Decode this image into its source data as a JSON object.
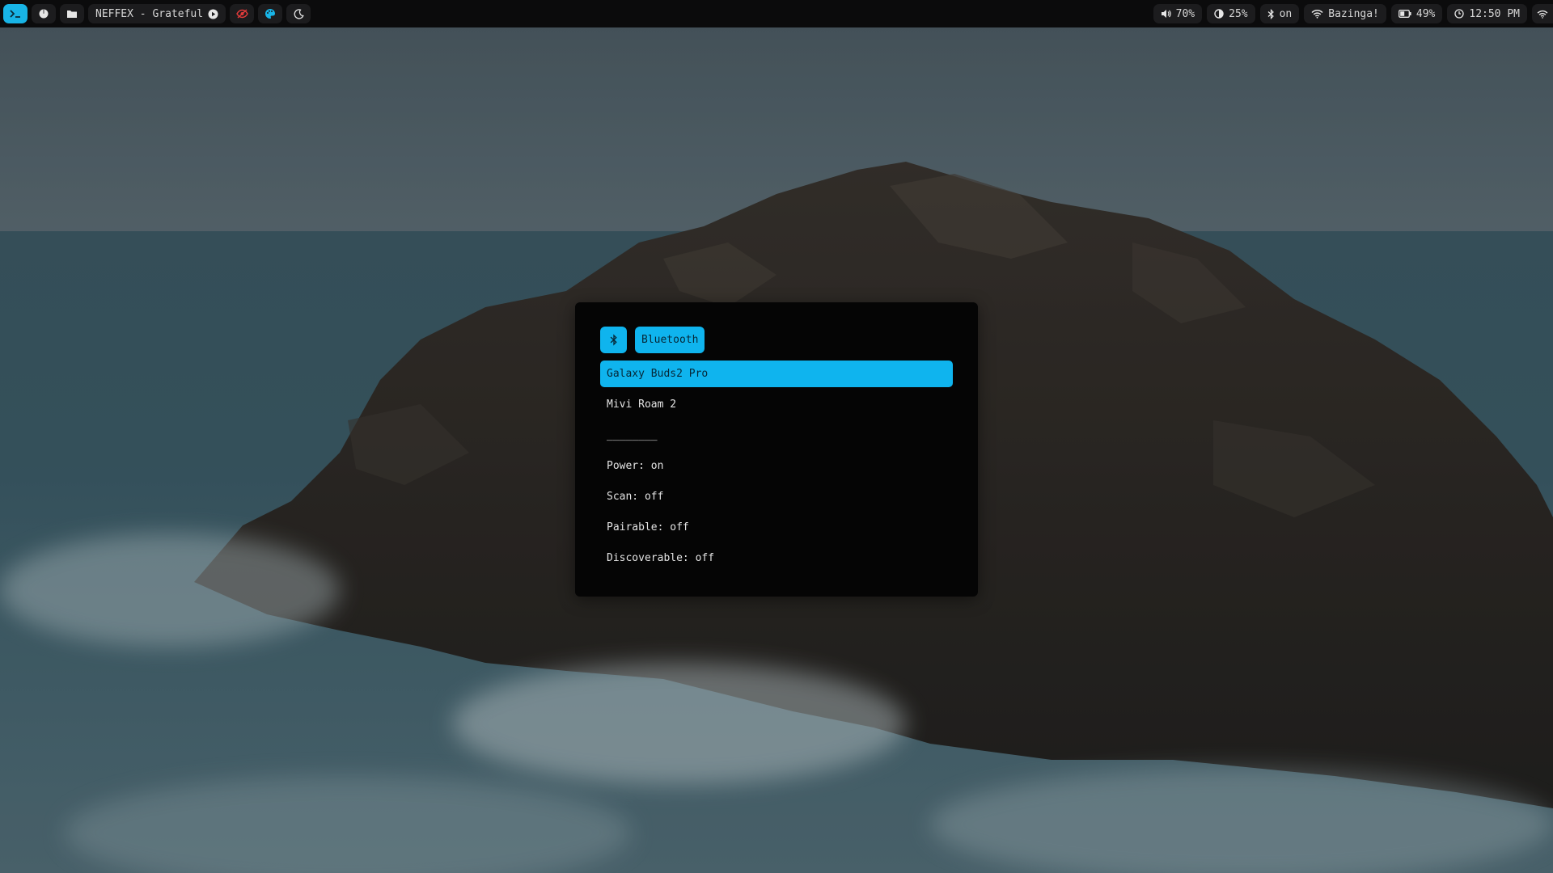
{
  "colors": {
    "accent": "#0fb4ee",
    "bar_bg": "#0b0b0c",
    "menu_bg": "#050505",
    "red_icon": "#e23b3b"
  },
  "topbar": {
    "left": {
      "terminal_icon": "terminal-icon",
      "power_icon": "power-icon",
      "folder_icon": "folder-icon",
      "media_title": "NEFFEX - Grateful",
      "media_play_icon": "play-circle-icon",
      "eye_off_icon": "eye-off-icon",
      "palette_icon": "palette-icon",
      "moon_icon": "moon-icon"
    },
    "right": {
      "volume_icon": "volume-icon",
      "volume": "70%",
      "brightness_icon": "brightness-icon",
      "brightness": "25%",
      "bluetooth_icon": "bluetooth-icon",
      "bluetooth": "on",
      "wifi_icon": "wifi-icon",
      "network": "Bazinga!",
      "battery_icon": "battery-icon",
      "battery": "49%",
      "clock_icon": "clock-icon",
      "time": "12:50 PM",
      "tray_wifi_icon": "wifi-icon"
    }
  },
  "bluetooth_menu": {
    "header_icon": "bluetooth-icon",
    "title": "Bluetooth",
    "devices": [
      {
        "label": "Galaxy Buds2 Pro",
        "selected": true
      },
      {
        "label": "Mivi Roam 2",
        "selected": false
      }
    ],
    "separator": "________",
    "options": [
      {
        "label": "Power: on"
      },
      {
        "label": "Scan: off"
      },
      {
        "label": "Pairable: off"
      },
      {
        "label": "Discoverable: off"
      }
    ]
  }
}
